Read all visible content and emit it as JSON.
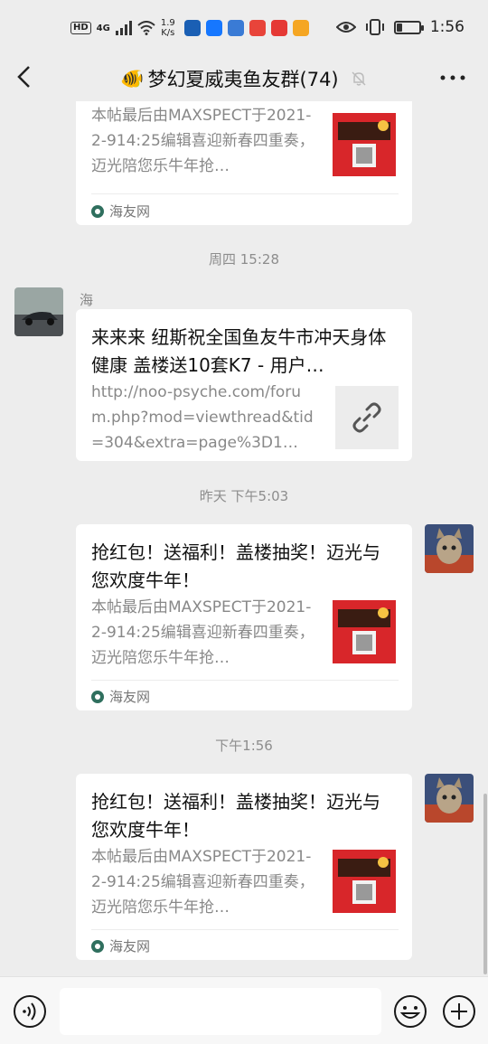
{
  "status_bar": {
    "hd": "HD",
    "network": "4G",
    "speed_value": "1.9",
    "speed_unit": "K/s",
    "time": "1:56",
    "battery_level": 0.25
  },
  "header": {
    "emoji": "🐠",
    "title": "梦幻夏威夷鱼友群(74)"
  },
  "messages": [
    {
      "desc": "本帖最后由MAXSPECT于2021-2-914:25编辑喜迎新春四重奏，迈光陪您乐牛年抢…",
      "source": "海友网"
    },
    {
      "timestamp": "周四 15:28",
      "sender": "海",
      "title": "来来来 纽斯祝全国鱼友牛市冲天身体健康 盖楼送10套K7 - 用户…",
      "url": "http://noo-psyche.com/forum.php?mod=viewthread&tid=304&extra=page%3D1…"
    },
    {
      "timestamp": "昨天 下午5:03",
      "title": "抢红包！送福利！盖楼抽奖！迈光与您欢度牛年！",
      "desc": "本帖最后由MAXSPECT于2021-2-914:25编辑喜迎新春四重奏，迈光陪您乐牛年抢…",
      "source": "海友网"
    },
    {
      "timestamp": "下午1:56",
      "title": "抢红包！送福利！盖楼抽奖！迈光与您欢度牛年！",
      "desc": "本帖最后由MAXSPECT于2021-2-914:25编辑喜迎新春四重奏，迈光陪您乐牛年抢…",
      "source": "海友网"
    }
  ],
  "icons": {
    "back": "back-arrow-icon",
    "mute": "bell-muted-icon",
    "more": "more-dots-icon",
    "voice": "voice-icon",
    "emoji": "emoji-icon",
    "plus": "plus-icon",
    "link": "link-icon"
  },
  "colors": {
    "background": "#ededed",
    "card": "#ffffff",
    "thumb_red": "#d8262a",
    "muted_text": "#888888"
  }
}
